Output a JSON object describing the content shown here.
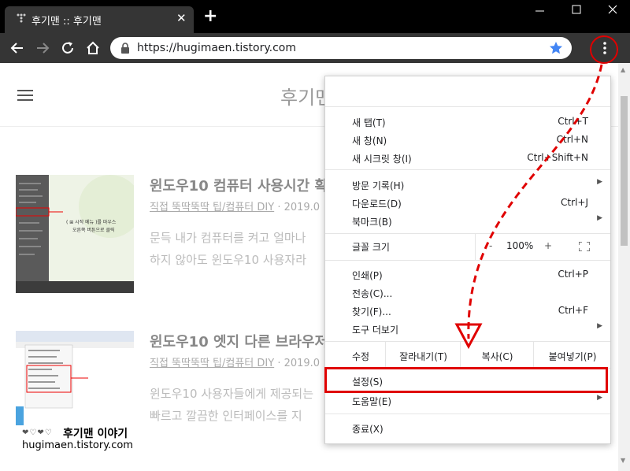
{
  "window": {
    "tab_title": "후기맨 :: 후기맨",
    "tab_close": "✕",
    "newtab_label": "+"
  },
  "toolbar": {
    "url": "https://hugimaen.tistory.com"
  },
  "page": {
    "blog_title": "후기맨",
    "posts": [
      {
        "title": "윈도우10 컴퓨터 사용시간 확",
        "category": "직접 뚝딱뚝딱 팁/컴퓨터 DIY",
        "date_sep": "·",
        "date": "2019.0",
        "excerpt_lines": [
          "문득 내가 컴퓨터를 켜고 얼마나",
          "하지 않아도 윈도우10 사용자라"
        ],
        "thumb_caption_line1": "( ⊞ 시작 메뉴 )를 마우스",
        "thumb_caption_line2": "오른쪽 버튼으로 클릭"
      },
      {
        "title": "윈도우10 엣지 다른 브라우저",
        "category": "직접 뚝딱뚝딱 팁/컴퓨터 DIY",
        "date_sep": "·",
        "date": "2019.0",
        "excerpt_lines": [
          "윈도우10 사용자들에게 제공되는",
          "빠르고 깔끔한 인터페이스를 지"
        ]
      }
    ],
    "watermark": {
      "name": "후기맨 이야기",
      "url": "hugimaen.tistory.com",
      "hearts": "❤♡❤♡"
    }
  },
  "menu": {
    "group1": [
      {
        "label": "새 탭(T)",
        "shortcut": "Ctrl+T"
      },
      {
        "label": "새 창(N)",
        "shortcut": "Ctrl+N"
      },
      {
        "label": "새 시크릿 창(I)",
        "shortcut": "Ctrl+Shift+N"
      }
    ],
    "group2": [
      {
        "label": "방문 기록(H)",
        "shortcut": ""
      },
      {
        "label": "다운로드(D)",
        "shortcut": "Ctrl+J"
      },
      {
        "label": "북마크(B)",
        "shortcut": ""
      }
    ],
    "zoom": {
      "label": "글꼴 크기",
      "minus": "-",
      "value": "100%",
      "plus": "+"
    },
    "group3": [
      {
        "label": "인쇄(P)",
        "shortcut": "Ctrl+P"
      },
      {
        "label": "전송(C)...",
        "shortcut": ""
      },
      {
        "label": "찾기(F)...",
        "shortcut": "Ctrl+F"
      },
      {
        "label": "도구 더보기",
        "shortcut": ""
      }
    ],
    "edit": {
      "label": "수정",
      "cut": "잘라내기(T)",
      "copy": "복사(C)",
      "paste": "붙여넣기(P)"
    },
    "settings": "설정(S)",
    "help": "도움말(E)",
    "exit": "종료(X)"
  },
  "colors": {
    "annotation_red": "#e00000",
    "star_blue": "#4285f4",
    "titlebar": "#000000",
    "toolbar": "#353535"
  }
}
